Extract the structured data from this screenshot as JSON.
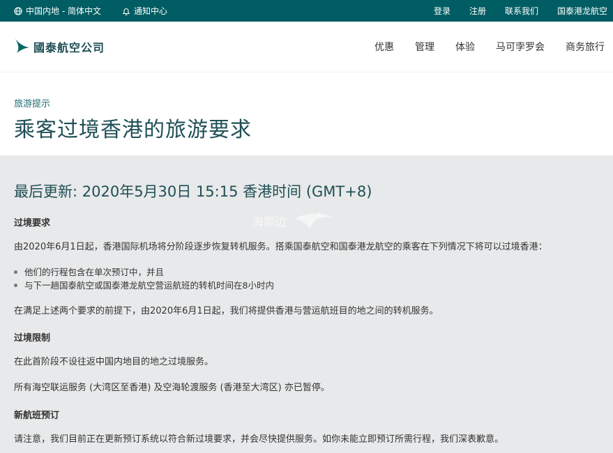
{
  "topbar": {
    "region": "中国内地 - 简体中文",
    "notifications": "通知中心",
    "links": [
      "登录",
      "注册",
      "联系我们",
      "国泰港龙航空"
    ]
  },
  "header": {
    "logo_text": "國泰航空公司",
    "nav": [
      "优惠",
      "管理",
      "体验",
      "马可孛罗会",
      "商务旅行"
    ]
  },
  "title_section": {
    "breadcrumb": "旅游提示",
    "title": "乘客过境香港的旅游要求"
  },
  "content": {
    "updated": "最后更新: 2020年5月30日 15:15 香港时间 (GMT+8)",
    "sections": [
      {
        "heading": "过境要求",
        "intro": "由2020年6月1日起，香港国际机场将分阶段逐步恢复转机服务。搭乘国泰航空和国泰港龙航空的乘客在下列情况下将可以过境香港：",
        "bullets": [
          "他们的行程包含在单次预订中，并且",
          "与下一趟国泰航空或国泰港龙航空营运航班的转机时间在8小时内"
        ],
        "outro": "在满足上述两个要求的前提下，由2020年6月1日起，我们将提供香港与营运航班目的地之间的转机服务。"
      },
      {
        "heading": "过境限制",
        "p1": "在此首阶段不设往返中国内地目的地之过境服务。",
        "p2": "所有海空联运服务 (大湾区至香港) 及空海轮渡服务 (香港至大湾区) 亦已暂停。"
      },
      {
        "heading": "新航班预订",
        "p1": "请注意，我们目前正在更新预订系统以符合新过境要求，并会尽快提供服务。如你未能立即预订所需行程，我们深表歉意。"
      }
    ]
  },
  "watermark": "海那边",
  "colors": {
    "topbar": "#005d63",
    "title": "#1f4f55",
    "breadcrumb": "#1f6b74",
    "content_bg": "#e8e9ea"
  }
}
